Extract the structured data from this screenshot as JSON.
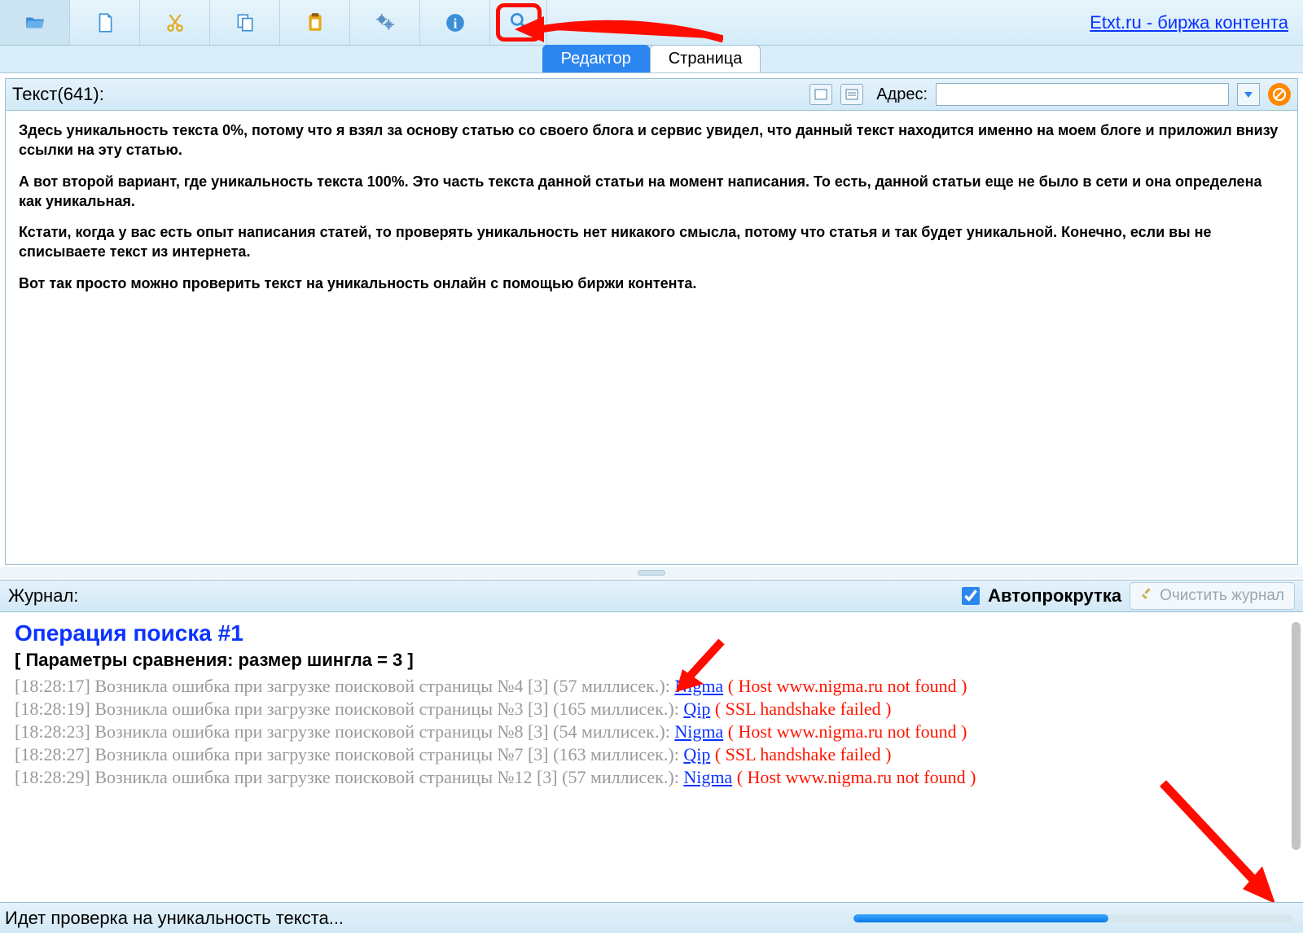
{
  "brand": {
    "link_text": "Etxt.ru - биржа контента"
  },
  "tabs": {
    "editor": "Редактор",
    "page": "Страница"
  },
  "text_header": {
    "label": "Текст(641):",
    "address_label": "Адрес:",
    "address_value": ""
  },
  "editor": {
    "paragraphs": [
      "Здесь уникальность текста 0%, потому что я взял за основу статью со своего блога и сервис увидел, что данный текст находится именно на моем блоге и приложил внизу ссылки на эту статью.",
      "А вот второй вариант, где уникальность текста 100%. Это часть текста данной статьи на момент написания. То есть, данной статьи еще не было в сети и она определена как уникальная.",
      "Кстати, когда у вас есть опыт написания статей, то проверять уникальность нет никакого смысла, потому что статья и так будет уникальной. Конечно, если вы не списываете текст из интернета.",
      "Вот так просто можно проверить текст на уникальность онлайн с помощью биржи контента."
    ]
  },
  "journal": {
    "label": "Журнал:",
    "autoscroll_label": "Автопрокрутка",
    "clear_label": "Очистить журнал",
    "operation_title": "Операция поиска #1",
    "params": "[ Параметры сравнения: размер шингла = 3 ]",
    "lines": [
      {
        "ts": "[18:28:17]",
        "msg": "Возникла ошибка при загрузке поисковой страницы №4 [3] (57 миллисек.): ",
        "engine": "Nigma",
        "err": " ( Host www.nigma.ru not found )"
      },
      {
        "ts": "[18:28:19]",
        "msg": "Возникла ошибка при загрузке поисковой страницы №3 [3] (165 миллисек.): ",
        "engine": "Qip",
        "err": " ( SSL handshake failed )"
      },
      {
        "ts": "[18:28:23]",
        "msg": "Возникла ошибка при загрузке поисковой страницы №8 [3] (54 миллисек.): ",
        "engine": "Nigma",
        "err": " ( Host www.nigma.ru not found )"
      },
      {
        "ts": "[18:28:27]",
        "msg": "Возникла ошибка при загрузке поисковой страницы №7 [3] (163 миллисек.): ",
        "engine": "Qip",
        "err": " ( SSL handshake failed )"
      },
      {
        "ts": "[18:28:29]",
        "msg": "Возникла ошибка при загрузке поисковой страницы №12 [3] (57 миллисек.): ",
        "engine": "Nigma",
        "err": " ( Host www.nigma.ru not found )"
      }
    ]
  },
  "status": {
    "text": "Идет проверка на уникальность текста...",
    "progress_percent": 58
  },
  "toolbar_icons": [
    "folder-open-icon",
    "new-file-icon",
    "cut-icon",
    "copy-icon",
    "paste-icon",
    "settings-icon",
    "info-icon",
    "search-icon"
  ],
  "colors": {
    "accent": "#2c86ef",
    "error": "#ff1500",
    "link": "#0a33ff",
    "highlight": "#ff0c00"
  }
}
